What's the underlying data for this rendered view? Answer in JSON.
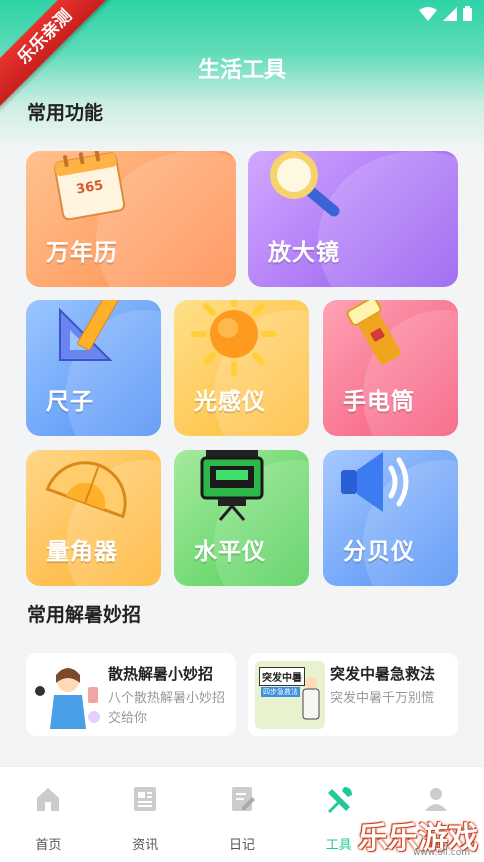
{
  "ribbon": {
    "text": "乐乐亲测"
  },
  "header": {
    "title": "生活工具"
  },
  "sections": {
    "common_functions": "常用功能",
    "summer_tips": "常用解暑妙招"
  },
  "tools": [
    {
      "label": "万年历",
      "color": "#ff8a4c",
      "icon": "calendar-icon"
    },
    {
      "label": "放大镜",
      "color": "#a066f0",
      "icon": "magnifier-icon"
    },
    {
      "label": "尺子",
      "color": "#4f8ff5",
      "icon": "ruler-icon"
    },
    {
      "label": "光感仪",
      "color": "#ffb933",
      "icon": "sun-icon"
    },
    {
      "label": "手电筒",
      "color": "#f5577a",
      "icon": "flashlight-icon"
    },
    {
      "label": "量角器",
      "color": "#ffb02a",
      "icon": "protractor-icon"
    },
    {
      "label": "水平仪",
      "color": "#4fcf57",
      "icon": "laser-level-icon"
    },
    {
      "label": "分贝仪",
      "color": "#4f8ff5",
      "icon": "speaker-icon"
    }
  ],
  "calendar_number": "365",
  "tips": [
    {
      "title": "散热解暑小妙招",
      "desc": "八个散热解暑小妙招交给你"
    },
    {
      "title": "突发中暑急救法",
      "desc": "突发中暑千万别慌",
      "thumb_title": "突发中暑",
      "thumb_sub": "四步急救法"
    }
  ],
  "tabs": [
    {
      "label": "首页",
      "icon": "home-icon"
    },
    {
      "label": "资讯",
      "icon": "news-icon"
    },
    {
      "label": "日记",
      "icon": "diary-icon"
    },
    {
      "label": "工具",
      "icon": "tools-icon",
      "active": true
    },
    {
      "label": "我的",
      "icon": "profile-icon"
    }
  ],
  "watermark": {
    "text": "乐乐游戏",
    "url": "www.6ll.com"
  },
  "colors": {
    "accent": "#24c99a",
    "header": "#2ed3a6"
  }
}
